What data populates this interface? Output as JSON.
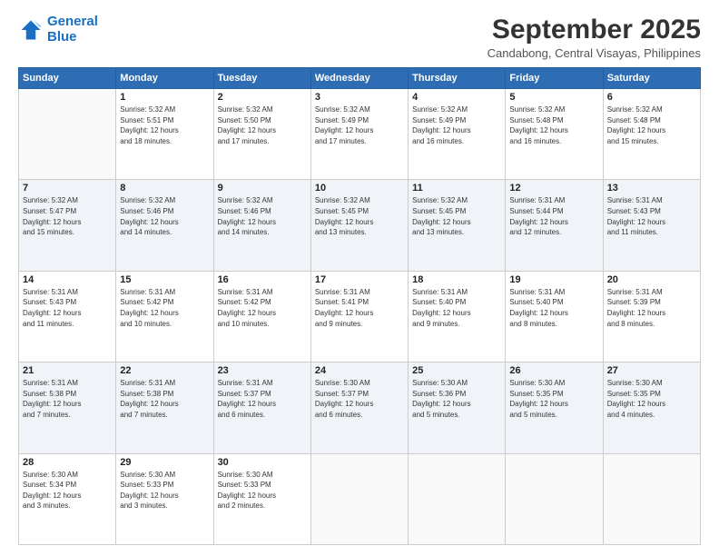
{
  "logo": {
    "line1": "General",
    "line2": "Blue"
  },
  "title": "September 2025",
  "subtitle": "Candabong, Central Visayas, Philippines",
  "header": {
    "days": [
      "Sunday",
      "Monday",
      "Tuesday",
      "Wednesday",
      "Thursday",
      "Friday",
      "Saturday"
    ]
  },
  "weeks": [
    [
      {
        "day": "",
        "info": ""
      },
      {
        "day": "1",
        "info": "Sunrise: 5:32 AM\nSunset: 5:51 PM\nDaylight: 12 hours\nand 18 minutes."
      },
      {
        "day": "2",
        "info": "Sunrise: 5:32 AM\nSunset: 5:50 PM\nDaylight: 12 hours\nand 17 minutes."
      },
      {
        "day": "3",
        "info": "Sunrise: 5:32 AM\nSunset: 5:49 PM\nDaylight: 12 hours\nand 17 minutes."
      },
      {
        "day": "4",
        "info": "Sunrise: 5:32 AM\nSunset: 5:49 PM\nDaylight: 12 hours\nand 16 minutes."
      },
      {
        "day": "5",
        "info": "Sunrise: 5:32 AM\nSunset: 5:48 PM\nDaylight: 12 hours\nand 16 minutes."
      },
      {
        "day": "6",
        "info": "Sunrise: 5:32 AM\nSunset: 5:48 PM\nDaylight: 12 hours\nand 15 minutes."
      }
    ],
    [
      {
        "day": "7",
        "info": "Sunrise: 5:32 AM\nSunset: 5:47 PM\nDaylight: 12 hours\nand 15 minutes."
      },
      {
        "day": "8",
        "info": "Sunrise: 5:32 AM\nSunset: 5:46 PM\nDaylight: 12 hours\nand 14 minutes."
      },
      {
        "day": "9",
        "info": "Sunrise: 5:32 AM\nSunset: 5:46 PM\nDaylight: 12 hours\nand 14 minutes."
      },
      {
        "day": "10",
        "info": "Sunrise: 5:32 AM\nSunset: 5:45 PM\nDaylight: 12 hours\nand 13 minutes."
      },
      {
        "day": "11",
        "info": "Sunrise: 5:32 AM\nSunset: 5:45 PM\nDaylight: 12 hours\nand 13 minutes."
      },
      {
        "day": "12",
        "info": "Sunrise: 5:31 AM\nSunset: 5:44 PM\nDaylight: 12 hours\nand 12 minutes."
      },
      {
        "day": "13",
        "info": "Sunrise: 5:31 AM\nSunset: 5:43 PM\nDaylight: 12 hours\nand 11 minutes."
      }
    ],
    [
      {
        "day": "14",
        "info": "Sunrise: 5:31 AM\nSunset: 5:43 PM\nDaylight: 12 hours\nand 11 minutes."
      },
      {
        "day": "15",
        "info": "Sunrise: 5:31 AM\nSunset: 5:42 PM\nDaylight: 12 hours\nand 10 minutes."
      },
      {
        "day": "16",
        "info": "Sunrise: 5:31 AM\nSunset: 5:42 PM\nDaylight: 12 hours\nand 10 minutes."
      },
      {
        "day": "17",
        "info": "Sunrise: 5:31 AM\nSunset: 5:41 PM\nDaylight: 12 hours\nand 9 minutes."
      },
      {
        "day": "18",
        "info": "Sunrise: 5:31 AM\nSunset: 5:40 PM\nDaylight: 12 hours\nand 9 minutes."
      },
      {
        "day": "19",
        "info": "Sunrise: 5:31 AM\nSunset: 5:40 PM\nDaylight: 12 hours\nand 8 minutes."
      },
      {
        "day": "20",
        "info": "Sunrise: 5:31 AM\nSunset: 5:39 PM\nDaylight: 12 hours\nand 8 minutes."
      }
    ],
    [
      {
        "day": "21",
        "info": "Sunrise: 5:31 AM\nSunset: 5:38 PM\nDaylight: 12 hours\nand 7 minutes."
      },
      {
        "day": "22",
        "info": "Sunrise: 5:31 AM\nSunset: 5:38 PM\nDaylight: 12 hours\nand 7 minutes."
      },
      {
        "day": "23",
        "info": "Sunrise: 5:31 AM\nSunset: 5:37 PM\nDaylight: 12 hours\nand 6 minutes."
      },
      {
        "day": "24",
        "info": "Sunrise: 5:30 AM\nSunset: 5:37 PM\nDaylight: 12 hours\nand 6 minutes."
      },
      {
        "day": "25",
        "info": "Sunrise: 5:30 AM\nSunset: 5:36 PM\nDaylight: 12 hours\nand 5 minutes."
      },
      {
        "day": "26",
        "info": "Sunrise: 5:30 AM\nSunset: 5:35 PM\nDaylight: 12 hours\nand 5 minutes."
      },
      {
        "day": "27",
        "info": "Sunrise: 5:30 AM\nSunset: 5:35 PM\nDaylight: 12 hours\nand 4 minutes."
      }
    ],
    [
      {
        "day": "28",
        "info": "Sunrise: 5:30 AM\nSunset: 5:34 PM\nDaylight: 12 hours\nand 3 minutes."
      },
      {
        "day": "29",
        "info": "Sunrise: 5:30 AM\nSunset: 5:33 PM\nDaylight: 12 hours\nand 3 minutes."
      },
      {
        "day": "30",
        "info": "Sunrise: 5:30 AM\nSunset: 5:33 PM\nDaylight: 12 hours\nand 2 minutes."
      },
      {
        "day": "",
        "info": ""
      },
      {
        "day": "",
        "info": ""
      },
      {
        "day": "",
        "info": ""
      },
      {
        "day": "",
        "info": ""
      }
    ]
  ]
}
